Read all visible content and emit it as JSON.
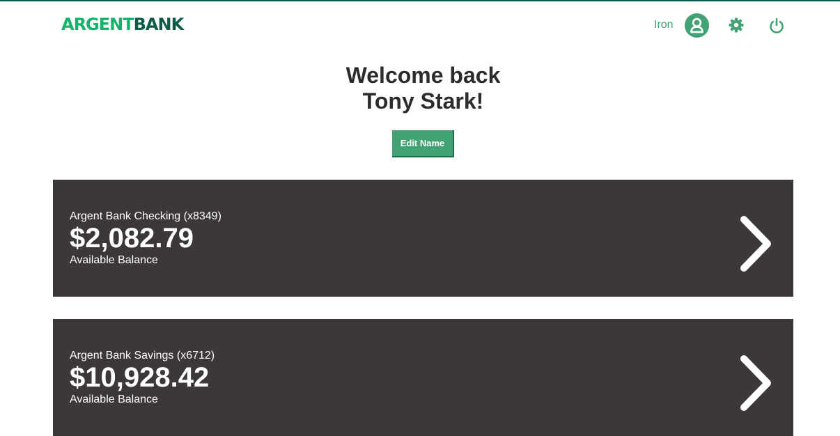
{
  "brand": {
    "part1": "ARGENT",
    "part2": "BANK"
  },
  "header": {
    "user_name": "Iron",
    "accent_color": "#42a273"
  },
  "welcome": {
    "line1": "Welcome back",
    "line2": "Tony Stark!"
  },
  "edit_button": {
    "label": "Edit Name"
  },
  "accounts": [
    {
      "title": "Argent Bank Checking (x8349)",
      "amount": "$2,082.79",
      "description": "Available Balance"
    },
    {
      "title": "Argent Bank Savings (x6712)",
      "amount": "$10,928.42",
      "description": "Available Balance"
    }
  ],
  "icons": [
    "user-avatar-icon",
    "gear-icon",
    "power-icon",
    "chevron-right-icon"
  ]
}
